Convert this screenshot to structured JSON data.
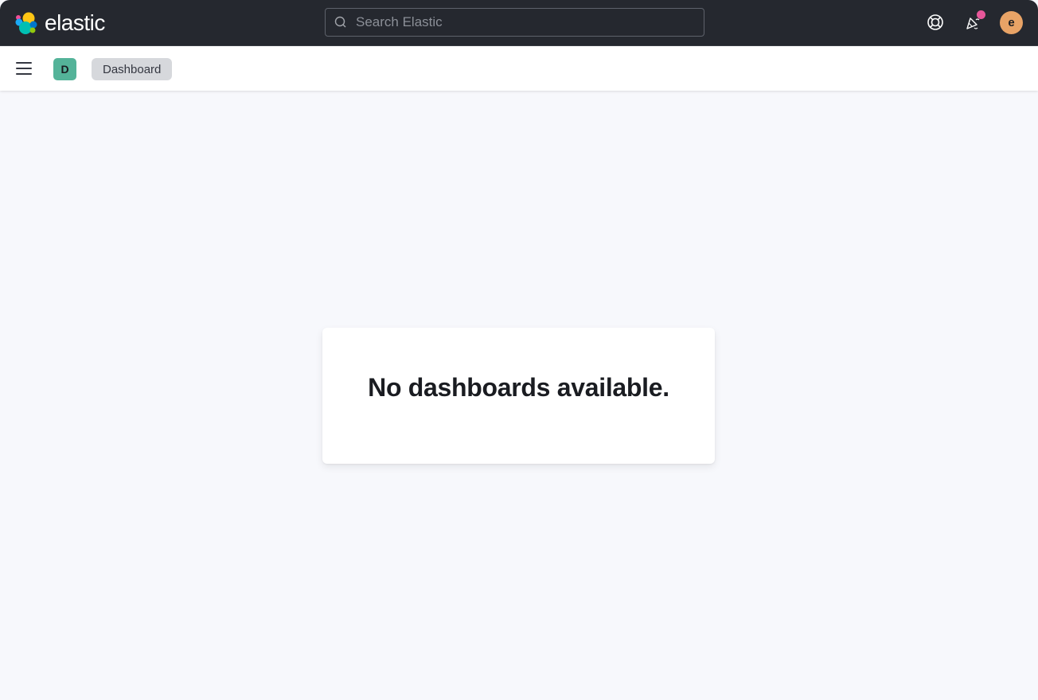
{
  "header": {
    "brand": "elastic",
    "search_placeholder": "Search Elastic",
    "icons": [
      "help-icon",
      "newsfeed-icon",
      "avatar"
    ],
    "avatar_initial": "e",
    "colors": {
      "header_bg": "#25282f",
      "avatar_bg": "#e8a366",
      "badge": "#e7579a"
    }
  },
  "subheader": {
    "space_initial": "D",
    "breadcrumb": "Dashboard",
    "colors": {
      "space_bg": "#54b399"
    }
  },
  "main": {
    "empty_message": "No dashboards available."
  }
}
